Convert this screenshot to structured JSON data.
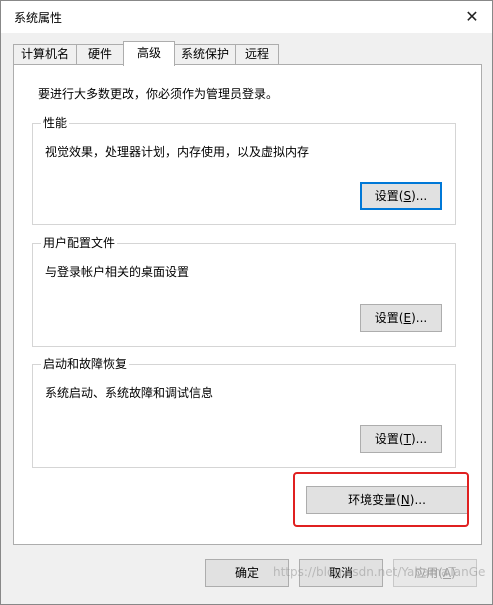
{
  "window": {
    "title": "系统属性",
    "close_glyph": "✕"
  },
  "tabs": [
    {
      "label": "计算机名",
      "active": false
    },
    {
      "label": "硬件",
      "active": false
    },
    {
      "label": "高级",
      "active": true
    },
    {
      "label": "系统保护",
      "active": false
    },
    {
      "label": "远程",
      "active": false
    }
  ],
  "advanced": {
    "admin_note": "要进行大多数更改，你必须作为管理员登录。",
    "performance": {
      "title": "性能",
      "description": "视觉效果，处理器计划，内存使用，以及虚拟内存",
      "button_label": "设置(",
      "button_key": "S",
      "button_suffix": ")..."
    },
    "user_profiles": {
      "title": "用户配置文件",
      "description": "与登录帐户相关的桌面设置",
      "button_label": "设置(",
      "button_key": "E",
      "button_suffix": ")..."
    },
    "startup_recovery": {
      "title": "启动和故障恢复",
      "description": "系统启动、系统故障和调试信息",
      "button_label": "设置(",
      "button_key": "T",
      "button_suffix": ")..."
    },
    "env_vars": {
      "button_label": "环境变量(",
      "button_key": "N",
      "button_suffix": ")..."
    }
  },
  "footer": {
    "ok_label": "确定",
    "cancel_label": "取消",
    "apply_label": "应用(",
    "apply_key": "A",
    "apply_suffix": ")"
  },
  "watermark": "https://blog.csdn.net/YabamaTanGe",
  "colors": {
    "highlight_border": "#e02020",
    "focus_border": "#0078d7"
  }
}
